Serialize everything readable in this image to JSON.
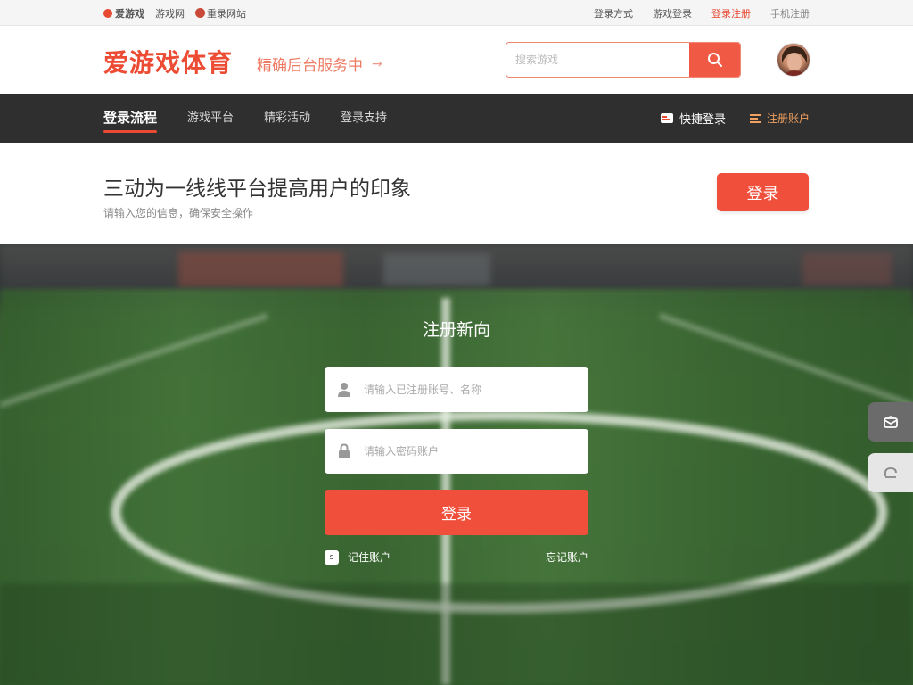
{
  "topbar": {
    "brand": "爱游戏",
    "link1": "游戏网",
    "link2": "重录网站",
    "right_links": [
      {
        "label": "登录方式"
      },
      {
        "label": "游戏登录"
      },
      {
        "label": "登录注册",
        "highlight": true
      },
      {
        "label": "手机注册"
      }
    ]
  },
  "header": {
    "brand": "爱游戏体育",
    "slogan": "精确后台服务中",
    "slogan_arrow": "→",
    "search_placeholder": "搜索游戏"
  },
  "nav": {
    "items": [
      {
        "label": "登录流程",
        "active": true
      },
      {
        "label": "游戏平台"
      },
      {
        "label": "精彩活动"
      },
      {
        "label": "登录支持"
      }
    ],
    "quick_login": "快捷登录",
    "register": "注册账户"
  },
  "banner": {
    "headline": "三动为一线线平台提高用户的印象",
    "subtext": "请输入您的信息，确保安全操作",
    "login_button": "登录"
  },
  "form": {
    "title": "注册新向",
    "username_placeholder": "请输入已注册账号、名称",
    "password_placeholder": "请输入密码账户",
    "submit": "登录",
    "remember": "记住账户",
    "forgot": "忘记账户"
  },
  "colors": {
    "accent": "#ef4f3b",
    "nav_bg": "#2f2f2f",
    "brand": "#ec4b34"
  },
  "icons": {
    "search": "search-icon",
    "user": "user-icon",
    "lock": "lock-icon",
    "side1": "mail-icon",
    "side2": "headset-icon"
  }
}
